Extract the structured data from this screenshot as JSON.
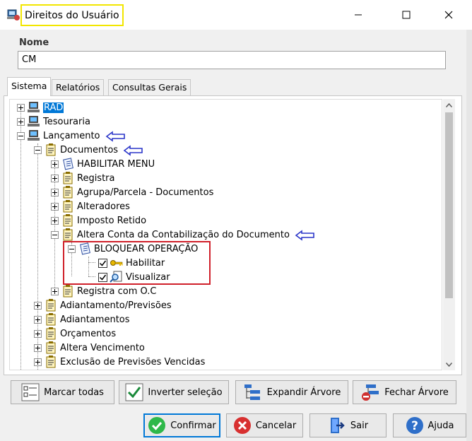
{
  "window": {
    "title": "Direitos do Usuário"
  },
  "form": {
    "name_label": "Nome",
    "name_value": "CM"
  },
  "tabs": [
    {
      "label": "Sistema",
      "active": true
    },
    {
      "label": "Relatórios",
      "active": false
    },
    {
      "label": "Consultas Gerais",
      "active": false
    }
  ],
  "tree": {
    "nodes": [
      {
        "label": "RAD",
        "selected": true
      },
      {
        "label": "Tesouraria"
      },
      {
        "label": "Lançamento"
      },
      {
        "label": "Documentos"
      },
      {
        "label": "HABILITAR MENU"
      },
      {
        "label": "Registra"
      },
      {
        "label": "Agrupa/Parcela - Documentos"
      },
      {
        "label": "Alteradores"
      },
      {
        "label": "Imposto Retido"
      },
      {
        "label": "Altera Conta da Contabilização do Documento"
      },
      {
        "label": "BLOQUEAR OPERAÇÃO"
      },
      {
        "label": "Habilitar",
        "checked": true
      },
      {
        "label": "Visualizar",
        "checked": true
      },
      {
        "label": "Registra com O.C"
      },
      {
        "label": "Adiantamento/Previsões"
      },
      {
        "label": "Adiantamentos"
      },
      {
        "label": "Orçamentos"
      },
      {
        "label": "Altera Vencimento"
      },
      {
        "label": "Exclusão de Previsões Vencidas"
      }
    ]
  },
  "actions": {
    "mark_all": "Marcar todas",
    "invert": "Inverter seleção",
    "expand": "Expandir Árvore",
    "collapse": "Fechar Árvore"
  },
  "footer": {
    "confirm": "Confirmar",
    "cancel": "Cancelar",
    "exit": "Sair",
    "help": "Ajuda"
  },
  "colors": {
    "accent": "#0078d7",
    "highlight_box": "#d0202a",
    "title_highlight": "#f2e600",
    "annotation_arrow": "#2a35c9"
  }
}
